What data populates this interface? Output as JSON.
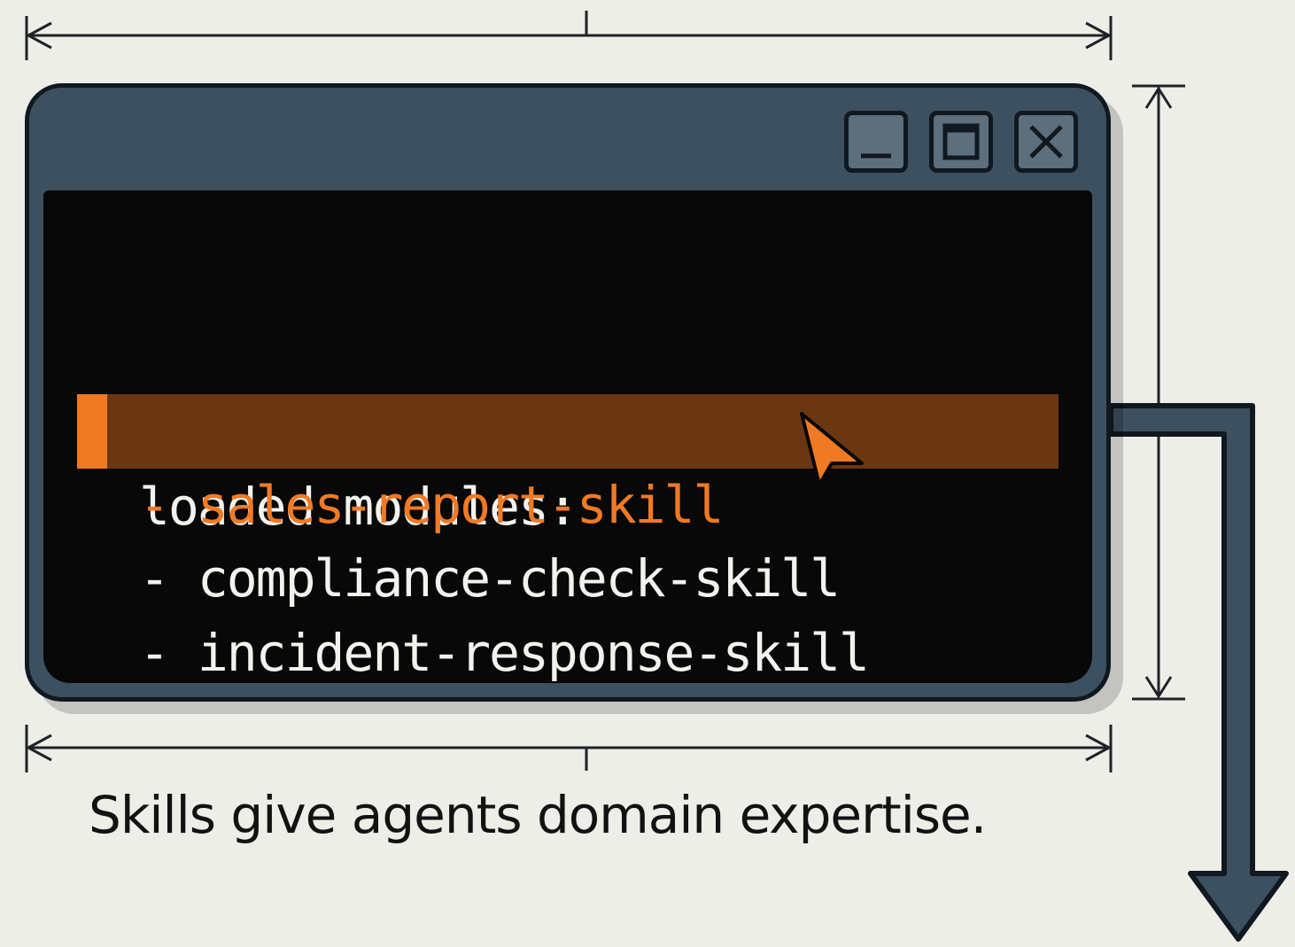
{
  "terminal": {
    "prompt_symbol": ">",
    "header": "loaded modules:",
    "modules": [
      "- sales-report-skill",
      "- compliance-check-skill",
      "- incident-response-skill"
    ],
    "highlighted_index": 0
  },
  "caption": "Skills give agents domain expertise.",
  "colors": {
    "background": "#eeeee9",
    "window_frame": "#3d5060",
    "terminal_bg": "#080808",
    "accent": "#f07a24",
    "highlight": "#6b3612",
    "text": "#f2f2ee"
  },
  "icons": [
    "minimize-icon",
    "maximize-icon",
    "close-icon",
    "mouse-cursor-icon",
    "down-arrow-icon"
  ]
}
